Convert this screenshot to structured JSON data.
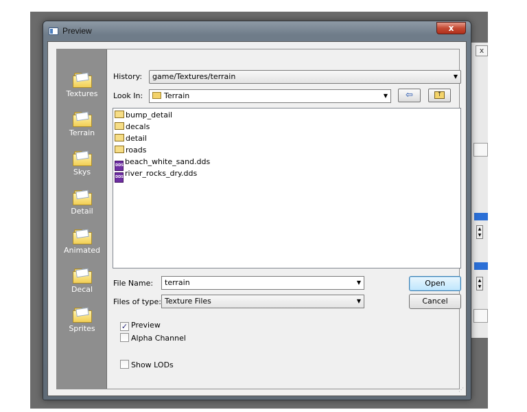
{
  "window": {
    "title": "Preview",
    "close_glyph": "x"
  },
  "background": {
    "close_glyph": "x"
  },
  "places": [
    {
      "label": "Textures",
      "icon": "folder-icon"
    },
    {
      "label": "Terrain",
      "icon": "folder-icon"
    },
    {
      "label": "Skys",
      "icon": "folder-icon"
    },
    {
      "label": "Detail",
      "icon": "folder-icon"
    },
    {
      "label": "Animated",
      "icon": "folder-icon"
    },
    {
      "label": "Decal",
      "icon": "folder-icon"
    },
    {
      "label": "Sprites",
      "icon": "folder-icon"
    }
  ],
  "history": {
    "label": "History:",
    "value": "game/Textures/terrain"
  },
  "look_in": {
    "label": "Look In:",
    "value": "Terrain"
  },
  "toolbar": {
    "back_glyph": "⇦",
    "up_glyph": "↑"
  },
  "files": [
    {
      "name": "bump_detail",
      "type": "folder"
    },
    {
      "name": "decals",
      "type": "folder"
    },
    {
      "name": "detail",
      "type": "folder"
    },
    {
      "name": "roads",
      "type": "folder"
    },
    {
      "name": "beach_white_sand.dds",
      "type": "dds"
    },
    {
      "name": "river_rocks_dry.dds",
      "type": "dds"
    }
  ],
  "dds_badge": "DDS",
  "file_name": {
    "label": "File Name:",
    "value": "terrain"
  },
  "file_type": {
    "label": "Files of type:",
    "value": "Texture Files"
  },
  "buttons": {
    "open": "Open",
    "cancel": "Cancel"
  },
  "options": {
    "preview": {
      "label": "Preview",
      "checked": true,
      "mark": "✓"
    },
    "alpha": {
      "label": "Alpha Channel",
      "checked": false
    },
    "lods": {
      "label": "Show LODs",
      "checked": false
    }
  },
  "dropdown_glyph": "▼"
}
